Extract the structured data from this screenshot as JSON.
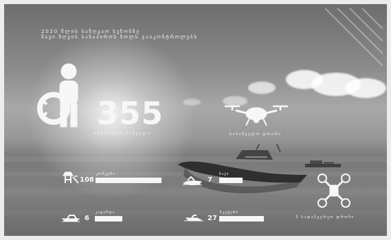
{
  "title": {
    "line1": "2020 წლის საზღვაო სეზონზე",
    "line2": "შავი ზღვის სანაპიროს ზოლს გააკონტროლებს"
  },
  "lifeguards": {
    "count": "355",
    "label": "სეზონური მაშველი"
  },
  "drones": {
    "label": "სამაშველო დრონი",
    "bottom_label": "3 სადაზვერვო დრონი"
  },
  "stats": {
    "towers": {
      "count": "108",
      "label": "კოშკური"
    },
    "jetskis": {
      "count": "7",
      "label": "ნავი"
    },
    "boats": {
      "count": "6",
      "label": "კატარღა"
    },
    "rescuejets": {
      "count": "27",
      "label": "სკუტერი"
    }
  },
  "icons": {
    "lifeguard": "lifeguard-person-icon",
    "drone": "drone-icon",
    "tower": "lifeguard-tower-icon",
    "boat": "boat-icon",
    "jetski": "jetski-icon",
    "scooter": "scooter-icon"
  },
  "colors": {
    "text": "#f5f5f5",
    "background": "#8b8b8b"
  }
}
